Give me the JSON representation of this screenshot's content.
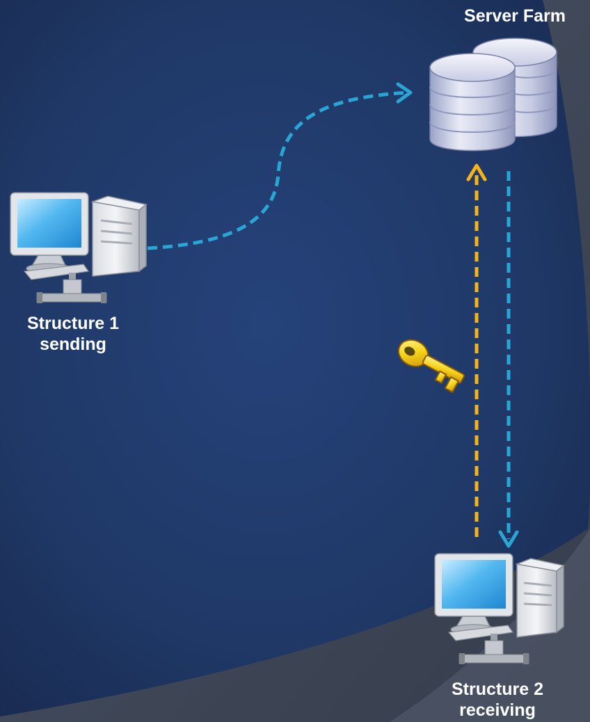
{
  "nodes": {
    "server_farm": {
      "label": "Server Farm"
    },
    "structure1": {
      "line1": "Structure 1",
      "line2": "sending"
    },
    "structure2": {
      "line1": "Structure 2",
      "line2": "receiving"
    }
  },
  "connectors": [
    {
      "from": "Structure 1",
      "to": "Server Farm",
      "style": "dashed",
      "color": "#2aa6d6"
    },
    {
      "from": "Structure 2",
      "to": "Server Farm",
      "style": "dashed",
      "color": "#f2b41a"
    },
    {
      "from": "Server Farm",
      "to": "Structure 2",
      "style": "dashed",
      "color": "#2aa6d6"
    }
  ],
  "icons": [
    "server-farm-icon",
    "computer-icon",
    "key-icon"
  ],
  "colors": {
    "background_outer": "#3d4658",
    "background_inner": "#1f3766",
    "send_arrow": "#2aa6d6",
    "key_arrow": "#f2b41a",
    "text": "#ffffff"
  }
}
